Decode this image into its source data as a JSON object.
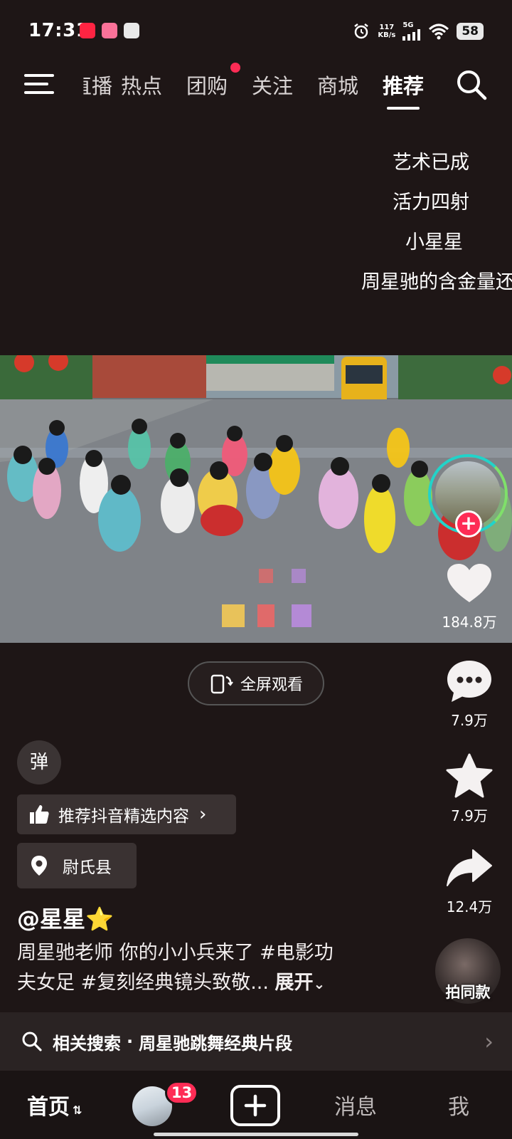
{
  "status_bar": {
    "time": "17:31",
    "network_speed_value": "117",
    "network_speed_unit": "KB/s",
    "network_type": "5G",
    "battery": "58",
    "icons": [
      "xiaohongshu-app-icon",
      "bilibili-app-icon",
      "avatar-app-icon",
      "alarm-icon",
      "signal-icon",
      "wifi-icon",
      "battery-icon"
    ]
  },
  "top_nav": {
    "tabs": [
      {
        "label": "播",
        "partial": true
      },
      {
        "label": "热点"
      },
      {
        "label": "团购",
        "has_dot": true
      },
      {
        "label": "关注"
      },
      {
        "label": "商城"
      },
      {
        "label": "推荐",
        "active": true
      }
    ],
    "icons": {
      "menu": "menu-icon",
      "search": "search-icon"
    }
  },
  "danmaku": [
    "艺术已成",
    "活力四射",
    "小星星",
    "周星驰的含金量还"
  ],
  "actions": {
    "likes": "184.8万",
    "comments": "7.9万",
    "favorites": "7.9万",
    "shares": "12.4万",
    "same_style_label": "拍同款"
  },
  "fullscreen_label": "全屏观看",
  "danmu_toggle_label": "弹",
  "recommend_chip": "推荐抖音精选内容",
  "location_chip": "尉氏县",
  "author": "@星星⭐",
  "description": {
    "line1": "周星驰老师 你的小小兵来了 #电影功",
    "line2": "夫女足 #复刻经典镜头致敬...",
    "expand": "展开"
  },
  "related_search": {
    "prefix": "相关搜索",
    "separator": "·",
    "query": "周星驰跳舞经典片段"
  },
  "bottom_nav": {
    "home": "首页",
    "friends_badge": "13",
    "messages": "消息",
    "me": "我"
  },
  "colors": {
    "background": "#1e1616",
    "accent_red": "#fe2c55",
    "ring_teal": "#22d3c9"
  }
}
